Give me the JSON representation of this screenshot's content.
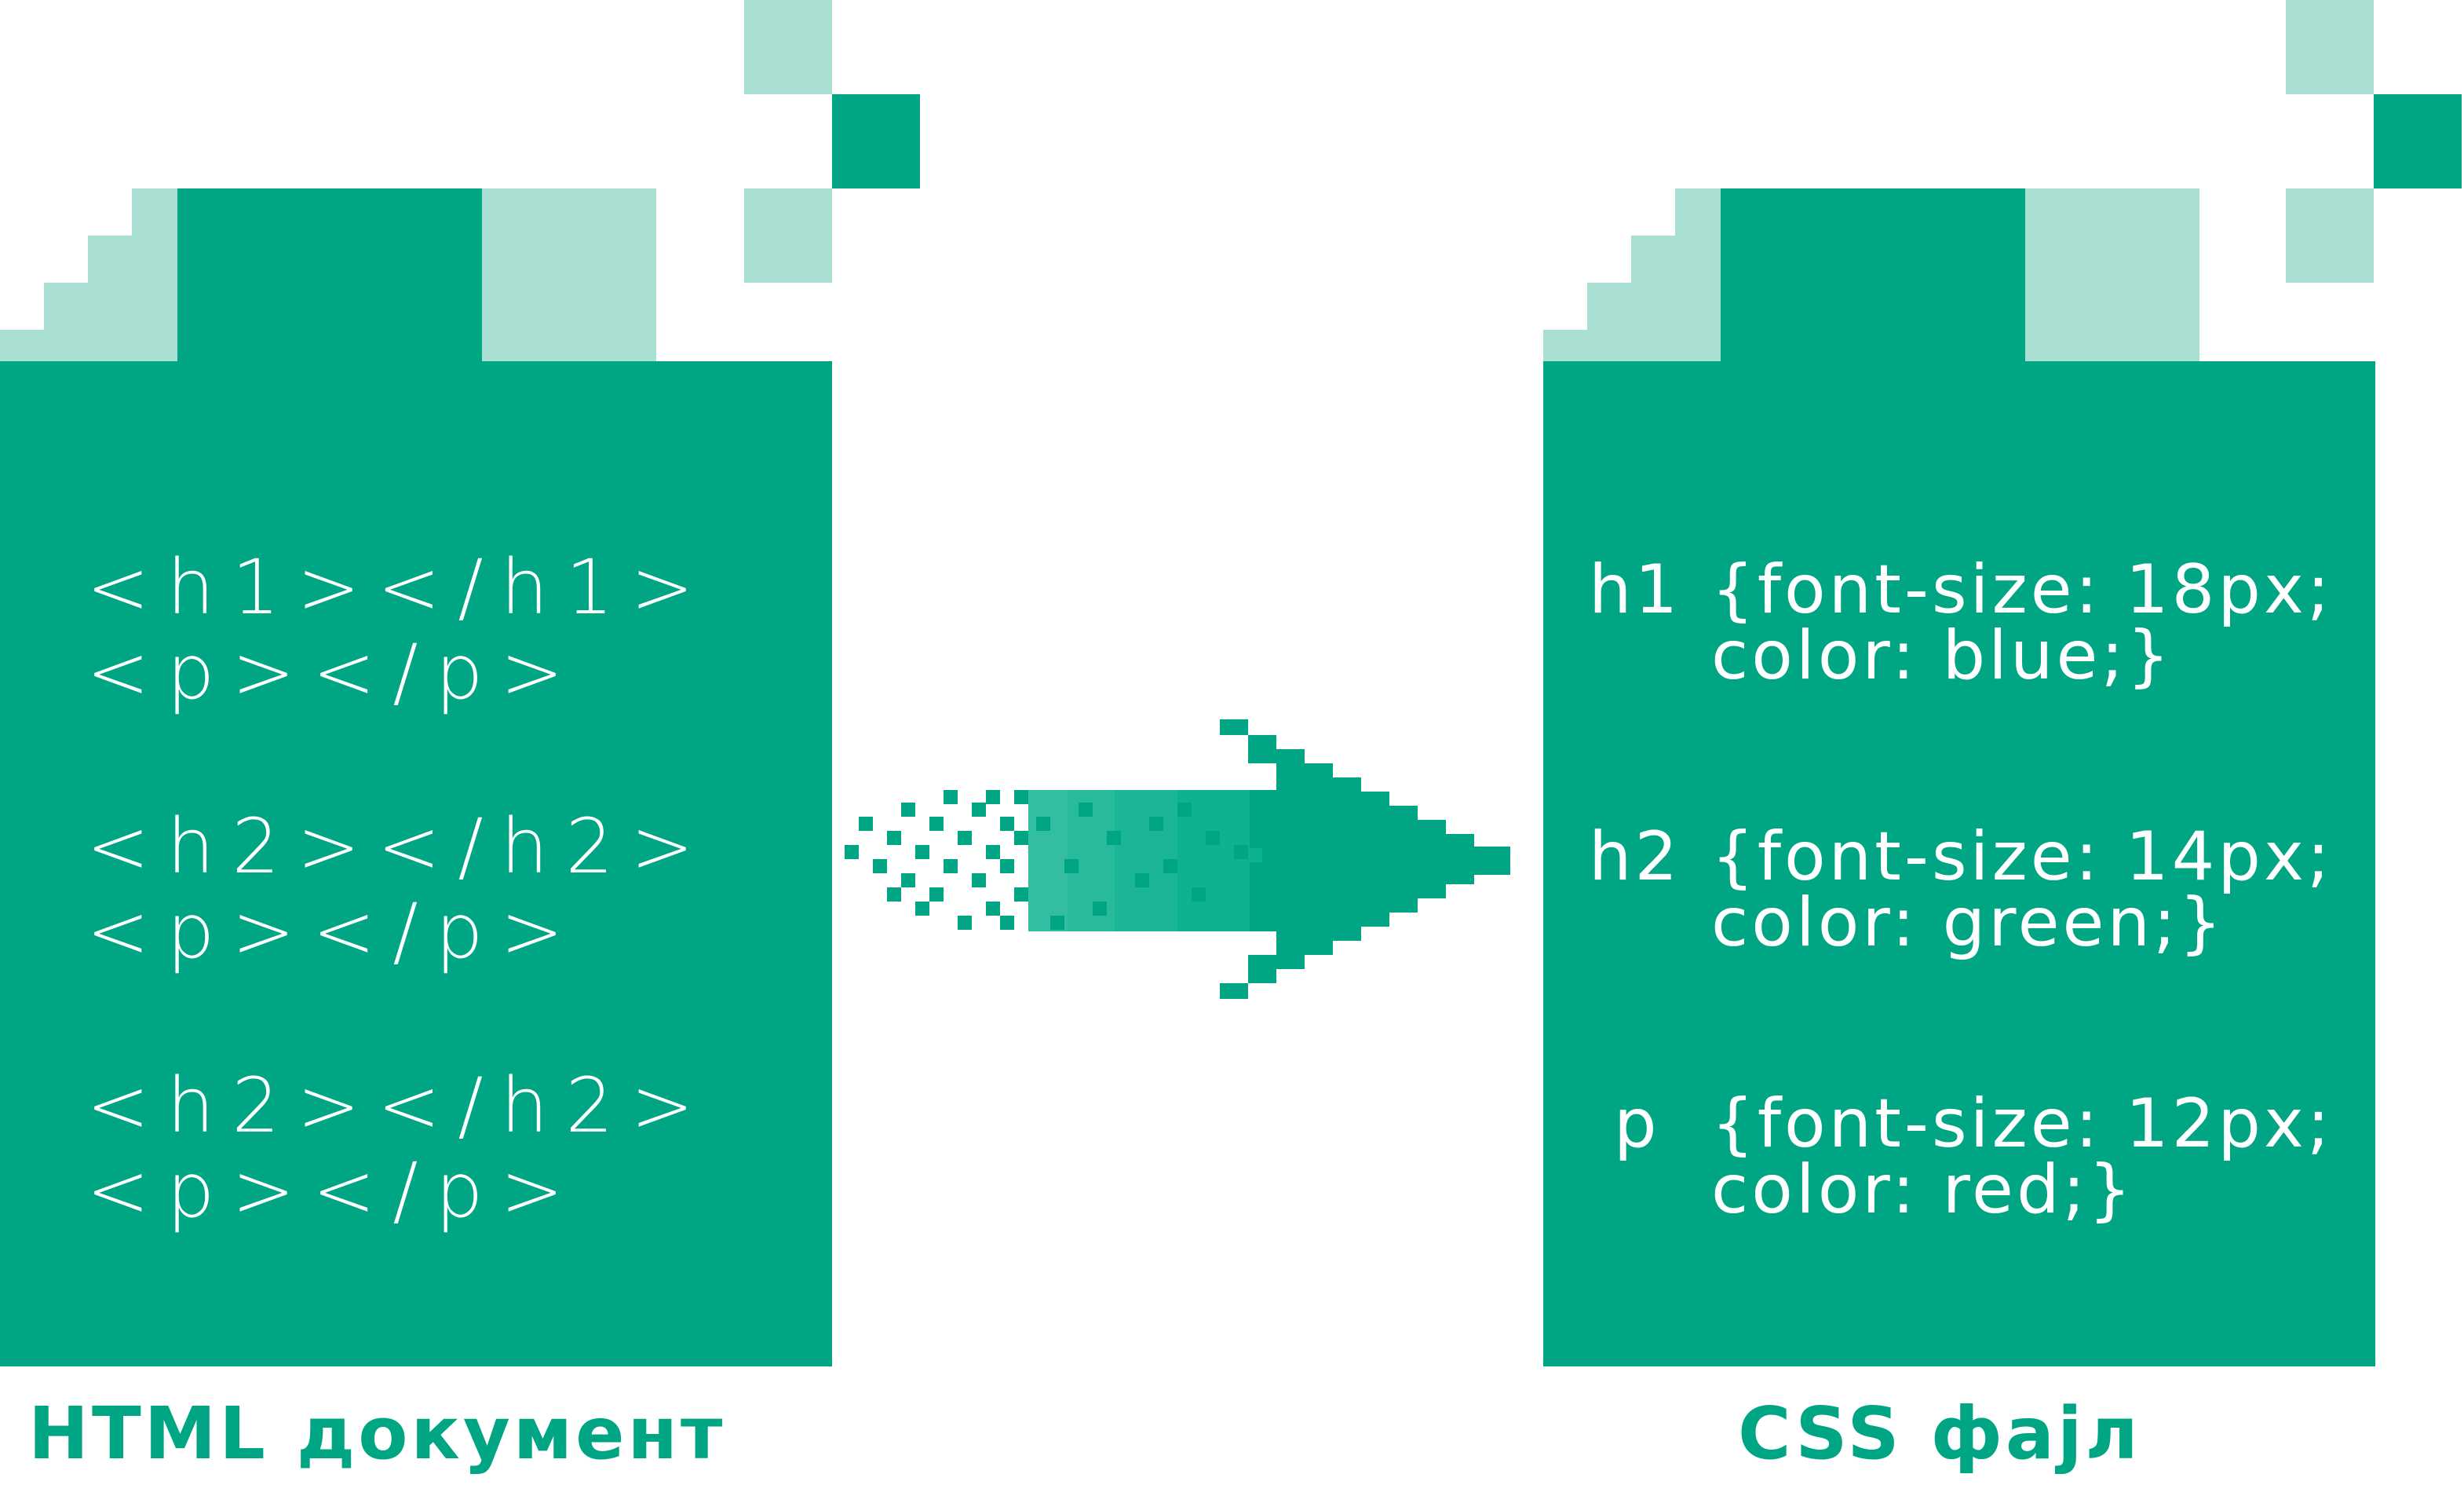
{
  "colors": {
    "primary": "#00a583",
    "light": "#aadfd3",
    "arrow_tail": "#0fb290",
    "background": "#ffffff"
  },
  "html_document": {
    "label": "HTML документ",
    "lines": [
      "<h1></h1>",
      "<p></p>",
      "<h2></h2>",
      "<p></p>",
      "<h2></h2>",
      "<p></p>"
    ]
  },
  "css_file": {
    "label": "CSS фајл",
    "rules": [
      {
        "selector": "h1",
        "line1": "{font-size: 18px;",
        "line2": "color: blue;}"
      },
      {
        "selector": "h2",
        "line1": "{font-size: 14px;",
        "line2": "color: green;}"
      },
      {
        "selector": "p",
        "line1": "{font-size: 12px;",
        "line2": "color: red;}"
      }
    ]
  }
}
